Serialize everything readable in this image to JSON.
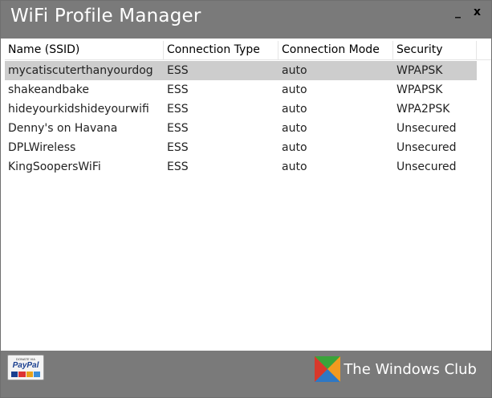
{
  "window": {
    "title": "WiFi Profile Manager",
    "minimize": "_",
    "close": "x"
  },
  "table": {
    "columns": [
      "Name (SSID)",
      "Connection Type",
      "Connection Mode",
      "Security"
    ],
    "rows": [
      {
        "ssid": "mycatiscuterthanyourdog",
        "type": "ESS",
        "mode": "auto",
        "security": "WPAPSK",
        "selected": true
      },
      {
        "ssid": "shakeandbake",
        "type": "ESS",
        "mode": "auto",
        "security": "WPAPSK"
      },
      {
        "ssid": "hideyourkidshideyourwifi",
        "type": "ESS",
        "mode": "auto",
        "security": "WPA2PSK"
      },
      {
        "ssid": "Denny's on Havana",
        "type": "ESS",
        "mode": "auto",
        "security": "Unsecured"
      },
      {
        "ssid": "DPLWireless",
        "type": "ESS",
        "mode": "auto",
        "security": "Unsecured"
      },
      {
        "ssid": "KingSoopersWiFi",
        "type": "ESS",
        "mode": "auto",
        "security": "Unsecured"
      }
    ]
  },
  "footer": {
    "donate_small": "DONATE VIA",
    "donate_logo": "PayPal",
    "brand_text": "The Windows Club",
    "brand_icon": "windows-club-icon"
  },
  "colors": {
    "titlebar": "#7a7a7a",
    "selected_row": "#cdcdcd",
    "brand_green": "#3aa33a",
    "brand_orange": "#f29a1f",
    "brand_blue": "#2f78c4",
    "brand_red": "#d8382b"
  }
}
